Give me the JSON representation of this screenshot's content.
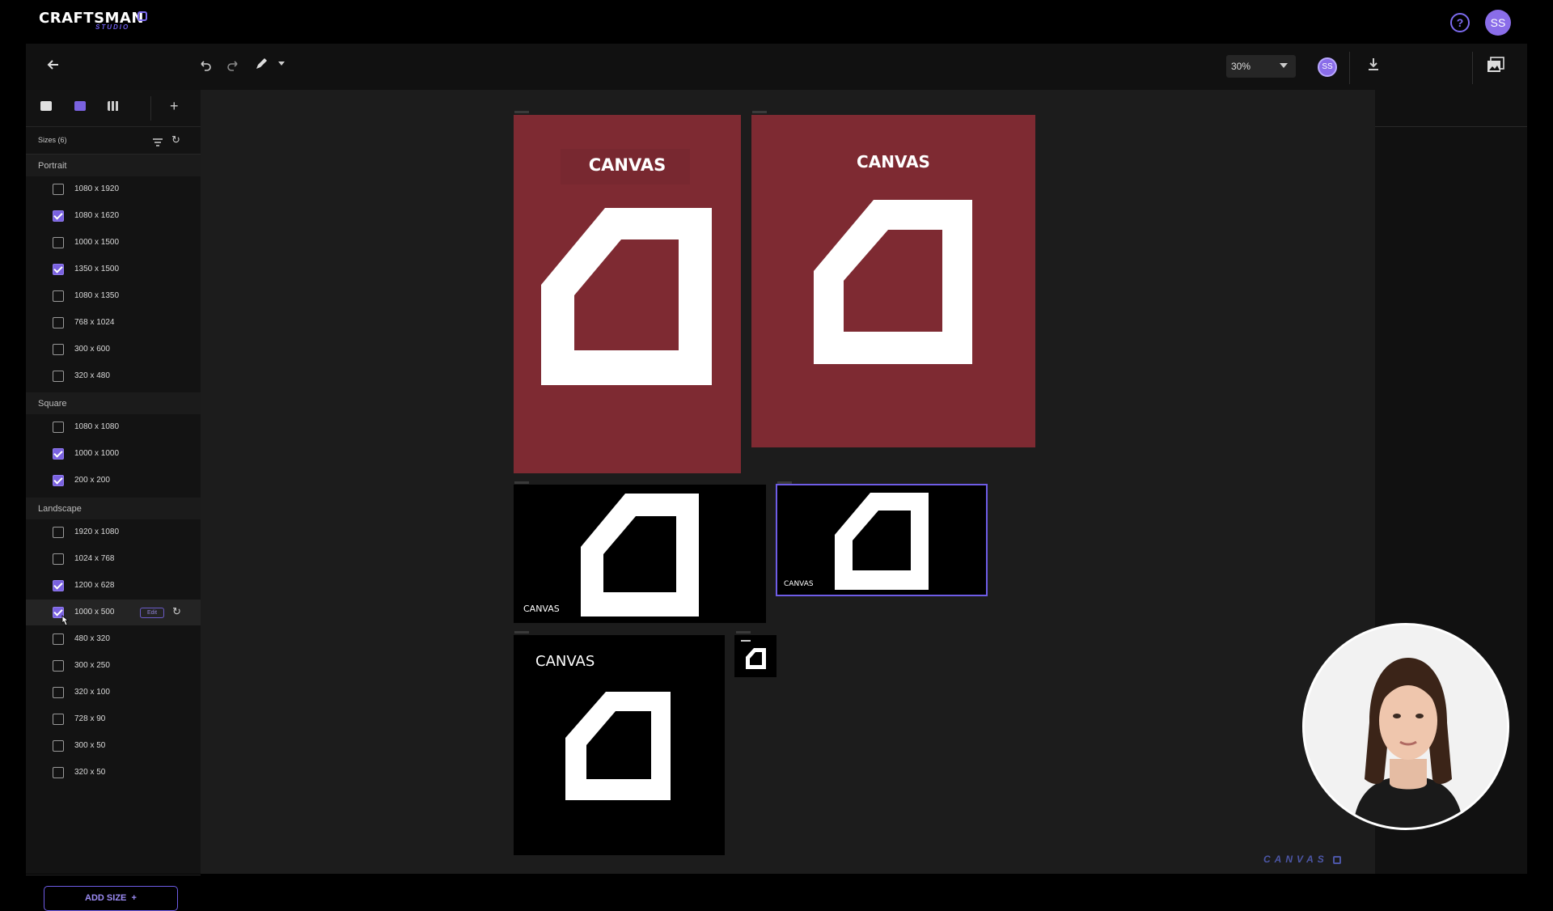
{
  "brand": {
    "name": "CRAFTSMAN",
    "sub": "STUDIO"
  },
  "header": {
    "help_icon": "question-circle-icon",
    "avatar_initials": "SS"
  },
  "toolbar": {
    "zoom": "30%",
    "avatar_initials": "SS"
  },
  "sidebar": {
    "sizes_title": "Sizes (6)",
    "groups": [
      {
        "label": "Portrait",
        "items": [
          {
            "label": "1080 x 1920",
            "checked": false
          },
          {
            "label": "1080 x 1620",
            "checked": true
          },
          {
            "label": "1000 x 1500",
            "checked": false
          },
          {
            "label": "1350 x 1500",
            "checked": true
          },
          {
            "label": "1080 x 1350",
            "checked": false
          },
          {
            "label": "768 x 1024",
            "checked": false
          },
          {
            "label": "300 x 600",
            "checked": false
          },
          {
            "label": "320 x 480",
            "checked": false
          }
        ]
      },
      {
        "label": "Square",
        "items": [
          {
            "label": "1080 x 1080",
            "checked": false
          },
          {
            "label": "1000 x 1000",
            "checked": true
          },
          {
            "label": "200 x 200",
            "checked": true
          }
        ]
      },
      {
        "label": "Landscape",
        "items": [
          {
            "label": "1920 x 1080",
            "checked": false
          },
          {
            "label": "1024 x 768",
            "checked": false
          },
          {
            "label": "1200 x 628",
            "checked": true
          },
          {
            "label": "1000 x 500",
            "checked": true,
            "edit": "Edit"
          },
          {
            "label": "480 x 320",
            "checked": false
          },
          {
            "label": "300 x 250",
            "checked": false
          },
          {
            "label": "320 x 100",
            "checked": false
          },
          {
            "label": "728 x 90",
            "checked": false
          },
          {
            "label": "300 x 50",
            "checked": false
          },
          {
            "label": "320 x 50",
            "checked": false
          }
        ]
      }
    ],
    "add_size": "ADD SIZE"
  },
  "artboards": {
    "a1_title": "CANVAS",
    "a2_title": "CANVAS",
    "a3_label": "CANVAS",
    "a4_label": "CANVAS",
    "a5_title": "CANVAS"
  },
  "watermark": "CANVAS",
  "colors": {
    "accent": "#7a62e0",
    "artboard_red": "#7e2a32"
  }
}
